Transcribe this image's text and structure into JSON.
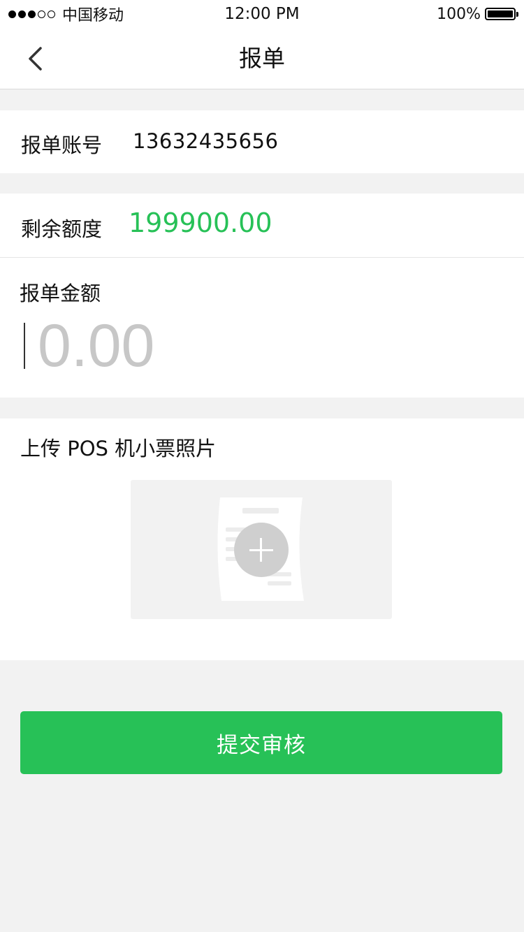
{
  "status_bar": {
    "carrier": "中国移动",
    "time": "12:00 PM",
    "battery": "100%",
    "signal_bars_filled": 3,
    "signal_bars_total": 5
  },
  "navbar": {
    "title": "报单",
    "back_icon": "chevron-left-icon"
  },
  "account": {
    "label": "报单账号",
    "value": "13632435656"
  },
  "quota": {
    "label": "剩余额度",
    "value": "199900.00",
    "value_color": "#27c157"
  },
  "amount": {
    "label": "报单金额",
    "placeholder": "0.00"
  },
  "upload": {
    "label": "上传 POS 机小票照片",
    "icon": "receipt-add-photo-icon"
  },
  "submit": {
    "label": "提交审核",
    "color": "#27c157"
  }
}
